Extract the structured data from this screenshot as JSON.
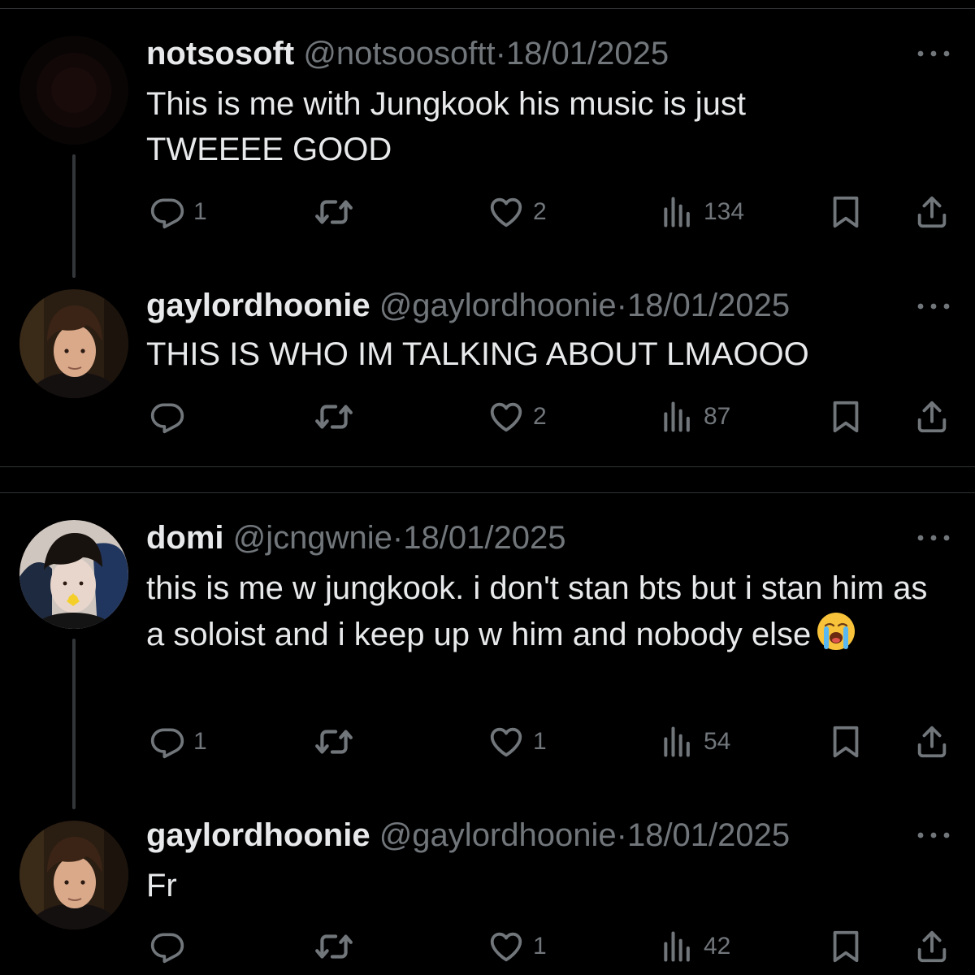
{
  "tweets": [
    {
      "display_name": "notsosoft",
      "handle": "@notsoosoftt",
      "date": "18/01/2025",
      "text": "This is me with Jungkook his music is just TWEEEE GOOD",
      "replies": "1",
      "retweets": "",
      "likes": "2",
      "views": "134"
    },
    {
      "display_name": "gaylordhoonie",
      "handle": "@gaylordhoonie",
      "date": "18/01/2025",
      "text": "THIS IS WHO IM TALKING ABOUT LMAOOO",
      "replies": "",
      "retweets": "",
      "likes": "2",
      "views": "87"
    },
    {
      "display_name": "domi",
      "handle": "@jcngwnie",
      "date": "18/01/2025",
      "text": "this is me w jungkook. i don't stan bts but i stan him as a soloist and i keep up w him and nobody else",
      "emoji": "loudly-crying-face",
      "replies": "1",
      "retweets": "",
      "likes": "1",
      "views": "54"
    },
    {
      "display_name": "gaylordhoonie",
      "handle": "@gaylordhoonie",
      "date": "18/01/2025",
      "text": "Fr",
      "replies": "",
      "retweets": "",
      "likes": "1",
      "views": "42"
    }
  ],
  "separator": "·",
  "icons": [
    "reply-icon",
    "retweet-icon",
    "like-icon",
    "views-icon",
    "bookmark-icon",
    "share-icon",
    "more-icon"
  ],
  "colors": {
    "background": "#000000",
    "text": "#e7e9ea",
    "secondary": "#71767b",
    "divider": "#2f3336",
    "thread_line": "#333639"
  }
}
